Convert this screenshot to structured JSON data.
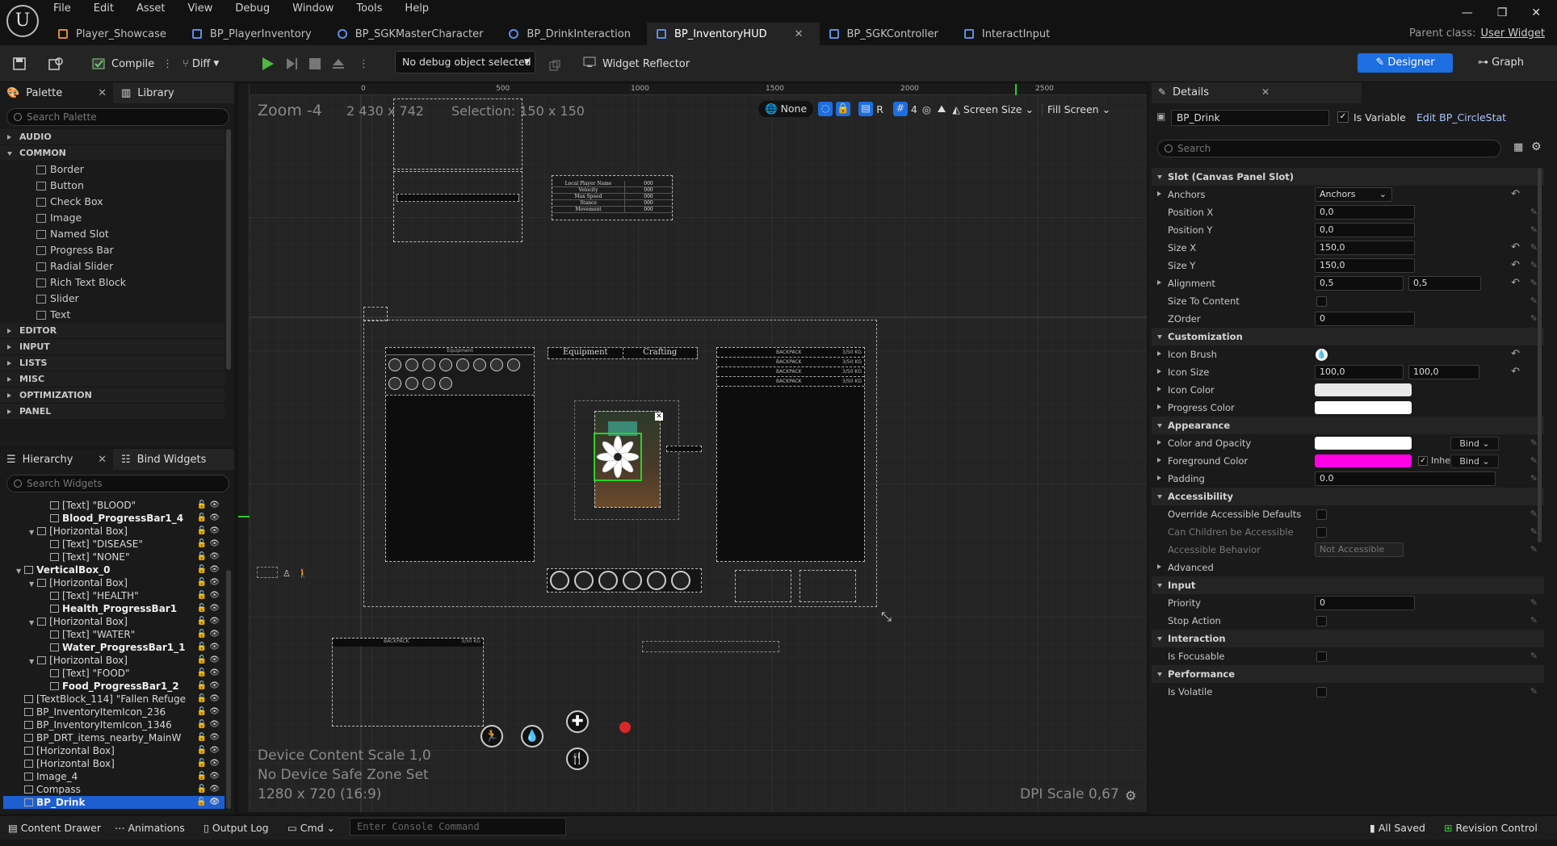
{
  "menu": [
    "File",
    "Edit",
    "Asset",
    "View",
    "Debug",
    "Window",
    "Tools",
    "Help"
  ],
  "tabs": [
    {
      "label": "Player_Showcase",
      "icon": "level-icon",
      "color": "#e28a2a"
    },
    {
      "label": "BP_PlayerInventory",
      "icon": "widget-icon",
      "color": "#5b8ee8"
    },
    {
      "label": "BP_SGKMasterCharacter",
      "icon": "character-icon",
      "color": "#5b8ee8"
    },
    {
      "label": "BP_DrinkInteraction",
      "icon": "character-icon",
      "color": "#5b8ee8"
    },
    {
      "label": "BP_InventoryHUD",
      "icon": "widget-icon",
      "color": "#5b8ee8",
      "active": true
    },
    {
      "label": "BP_SGKController",
      "icon": "controller-icon",
      "color": "#5b8ee8"
    },
    {
      "label": "InteractInput",
      "icon": "input-icon",
      "color": "#5b8ee8"
    }
  ],
  "parent_class": {
    "label": "Parent class:",
    "value": "User Widget"
  },
  "toolbar": {
    "compile": "Compile",
    "diff": "Diff",
    "debug_object": "No debug object selected",
    "widget_reflector": "Widget Reflector",
    "designer": "Designer",
    "graph": "Graph"
  },
  "palette": {
    "title": "Palette",
    "library": "Library",
    "search_placeholder": "Search Palette",
    "categories_top": [
      "AUDIO",
      "COMMON"
    ],
    "common_items": [
      "Border",
      "Button",
      "Check Box",
      "Image",
      "Named Slot",
      "Progress Bar",
      "Radial Slider",
      "Rich Text Block",
      "Slider",
      "Text"
    ],
    "categories_bottom": [
      "EDITOR",
      "INPUT",
      "LISTS",
      "MISC",
      "OPTIMIZATION",
      "PANEL"
    ]
  },
  "hierarchy": {
    "title": "Hierarchy",
    "bind_widgets": "Bind Widgets",
    "search_placeholder": "Search Widgets",
    "rows": [
      {
        "text": "[Text] \"BLOOD\"",
        "indent": 3,
        "icon": "T"
      },
      {
        "text": "Blood_ProgressBar1_4",
        "indent": 3,
        "bold": true
      },
      {
        "text": "[Horizontal Box]",
        "indent": 2,
        "expand": true
      },
      {
        "text": "[Text] \"DISEASE\"",
        "indent": 3
      },
      {
        "text": "[Text] \"NONE\"",
        "indent": 3
      },
      {
        "text": "VerticalBox_0",
        "indent": 1,
        "bold": true,
        "expand": true
      },
      {
        "text": "[Horizontal Box]",
        "indent": 2,
        "expand": true
      },
      {
        "text": "[Text] \"HEALTH\"",
        "indent": 3
      },
      {
        "text": "Health_ProgressBar1",
        "indent": 3,
        "bold": true
      },
      {
        "text": "[Horizontal Box]",
        "indent": 2,
        "expand": true
      },
      {
        "text": "[Text] \"WATER\"",
        "indent": 3
      },
      {
        "text": "Water_ProgressBar1_1",
        "indent": 3,
        "bold": true
      },
      {
        "text": "[Horizontal Box]",
        "indent": 2,
        "expand": true
      },
      {
        "text": "[Text] \"FOOD\"",
        "indent": 3
      },
      {
        "text": "Food_ProgressBar1_2",
        "indent": 3,
        "bold": true
      },
      {
        "text": "[TextBlock_114] \"Fallen Refuge",
        "indent": 1
      },
      {
        "text": "BP_InventoryItemIcon_236",
        "indent": 1
      },
      {
        "text": "BP_InventoryItemIcon_1346",
        "indent": 1
      },
      {
        "text": "BP_DRT_items_nearby_MainW",
        "indent": 1
      },
      {
        "text": "[Horizontal Box]",
        "indent": 1
      },
      {
        "text": "[Horizontal Box]",
        "indent": 1
      },
      {
        "text": "Image_4",
        "indent": 1
      },
      {
        "text": "Compass",
        "indent": 1
      },
      {
        "text": "BP_Drink",
        "indent": 1,
        "bold": true,
        "selected": true
      }
    ]
  },
  "canvas": {
    "zoom": "Zoom -4",
    "resolution": "2 430 x 742",
    "selection": "Selection: 150 x 150",
    "ruler_labels": [
      "0",
      "500",
      "1000",
      "1500",
      "2000",
      "2500"
    ],
    "viewport_opts": {
      "none": "None",
      "r": "R",
      "grid": "4",
      "screen_size": "Screen Size",
      "fill_screen": "Fill Screen"
    },
    "device_scale": "Device Content Scale 1,0",
    "safe_zone": "No Device Safe Zone Set",
    "res_info": "1280 x 720 (16:9)",
    "dpi": "DPI Scale 0,67",
    "hud_labels": {
      "equipment": "Equipment",
      "crafting": "Crafting",
      "backpack": "BACKPACK",
      "capacity": "3/50 KG",
      "tab_equipment": "Equipment"
    },
    "stat_table": [
      [
        "Local Player Name",
        "000"
      ],
      [
        "Velocity",
        "000"
      ],
      [
        "Max Speed",
        "000"
      ],
      [
        "Stance",
        "000"
      ],
      [
        "Movement",
        "000"
      ]
    ]
  },
  "details": {
    "title": "Details",
    "widget_name": "BP_Drink",
    "is_variable": "Is Variable",
    "edit_link": "Edit BP_CircleStat",
    "search_placeholder": "Search",
    "slot_section": "Slot (Canvas Panel Slot)",
    "slot_rows": [
      {
        "label": "Anchors",
        "value": "Anchors",
        "type": "dropdown",
        "expand": true
      },
      {
        "label": "Position X",
        "value": "0,0"
      },
      {
        "label": "Position Y",
        "value": "0,0"
      },
      {
        "label": "Size X",
        "value": "150,0"
      },
      {
        "label": "Size Y",
        "value": "150,0"
      },
      {
        "label": "Alignment",
        "value": "0,5",
        "value2": "0,5",
        "expand": true
      },
      {
        "label": "Size To Content",
        "type": "check"
      },
      {
        "label": "ZOrder",
        "value": "0"
      }
    ],
    "customization": "Customization",
    "custom_rows": [
      {
        "label": "Icon Brush",
        "type": "icon"
      },
      {
        "label": "Icon Size",
        "value": "100,0",
        "value2": "100,0"
      },
      {
        "label": "Icon Color",
        "type": "color",
        "color": "#e8e8e8"
      },
      {
        "label": "Progress Color",
        "type": "color",
        "color": "#ffffff"
      }
    ],
    "appearance": "Appearance",
    "appearance_rows": [
      {
        "label": "Color and Opacity",
        "color": "#ffffff",
        "bind": "Bind"
      },
      {
        "label": "Foreground Color",
        "color": "#ff00e6",
        "inherit": "Inherit",
        "bind": "Bind"
      },
      {
        "label": "Padding",
        "value": "0.0"
      }
    ],
    "accessibility": "Accessibility",
    "access_rows": [
      {
        "label": "Override Accessible Defaults"
      },
      {
        "label": "Can Children be Accessible"
      },
      {
        "label": "Accessible Behavior",
        "value": "Not Accessible"
      },
      {
        "label": "Advanced"
      }
    ],
    "input": "Input",
    "input_rows": [
      {
        "label": "Priority",
        "value": "0"
      },
      {
        "label": "Stop Action"
      }
    ],
    "interaction": "Interaction",
    "interaction_rows": [
      {
        "label": "Is Focusable"
      }
    ],
    "performance": "Performance",
    "performance_rows": [
      {
        "label": "Is Volatile"
      }
    ]
  },
  "statusbar": {
    "content_drawer": "Content Drawer",
    "animations": "Animations",
    "output_log": "Output Log",
    "cmd": "Cmd",
    "console_placeholder": "Enter Console Command",
    "all_saved": "All Saved",
    "revision_control": "Revision Control"
  }
}
